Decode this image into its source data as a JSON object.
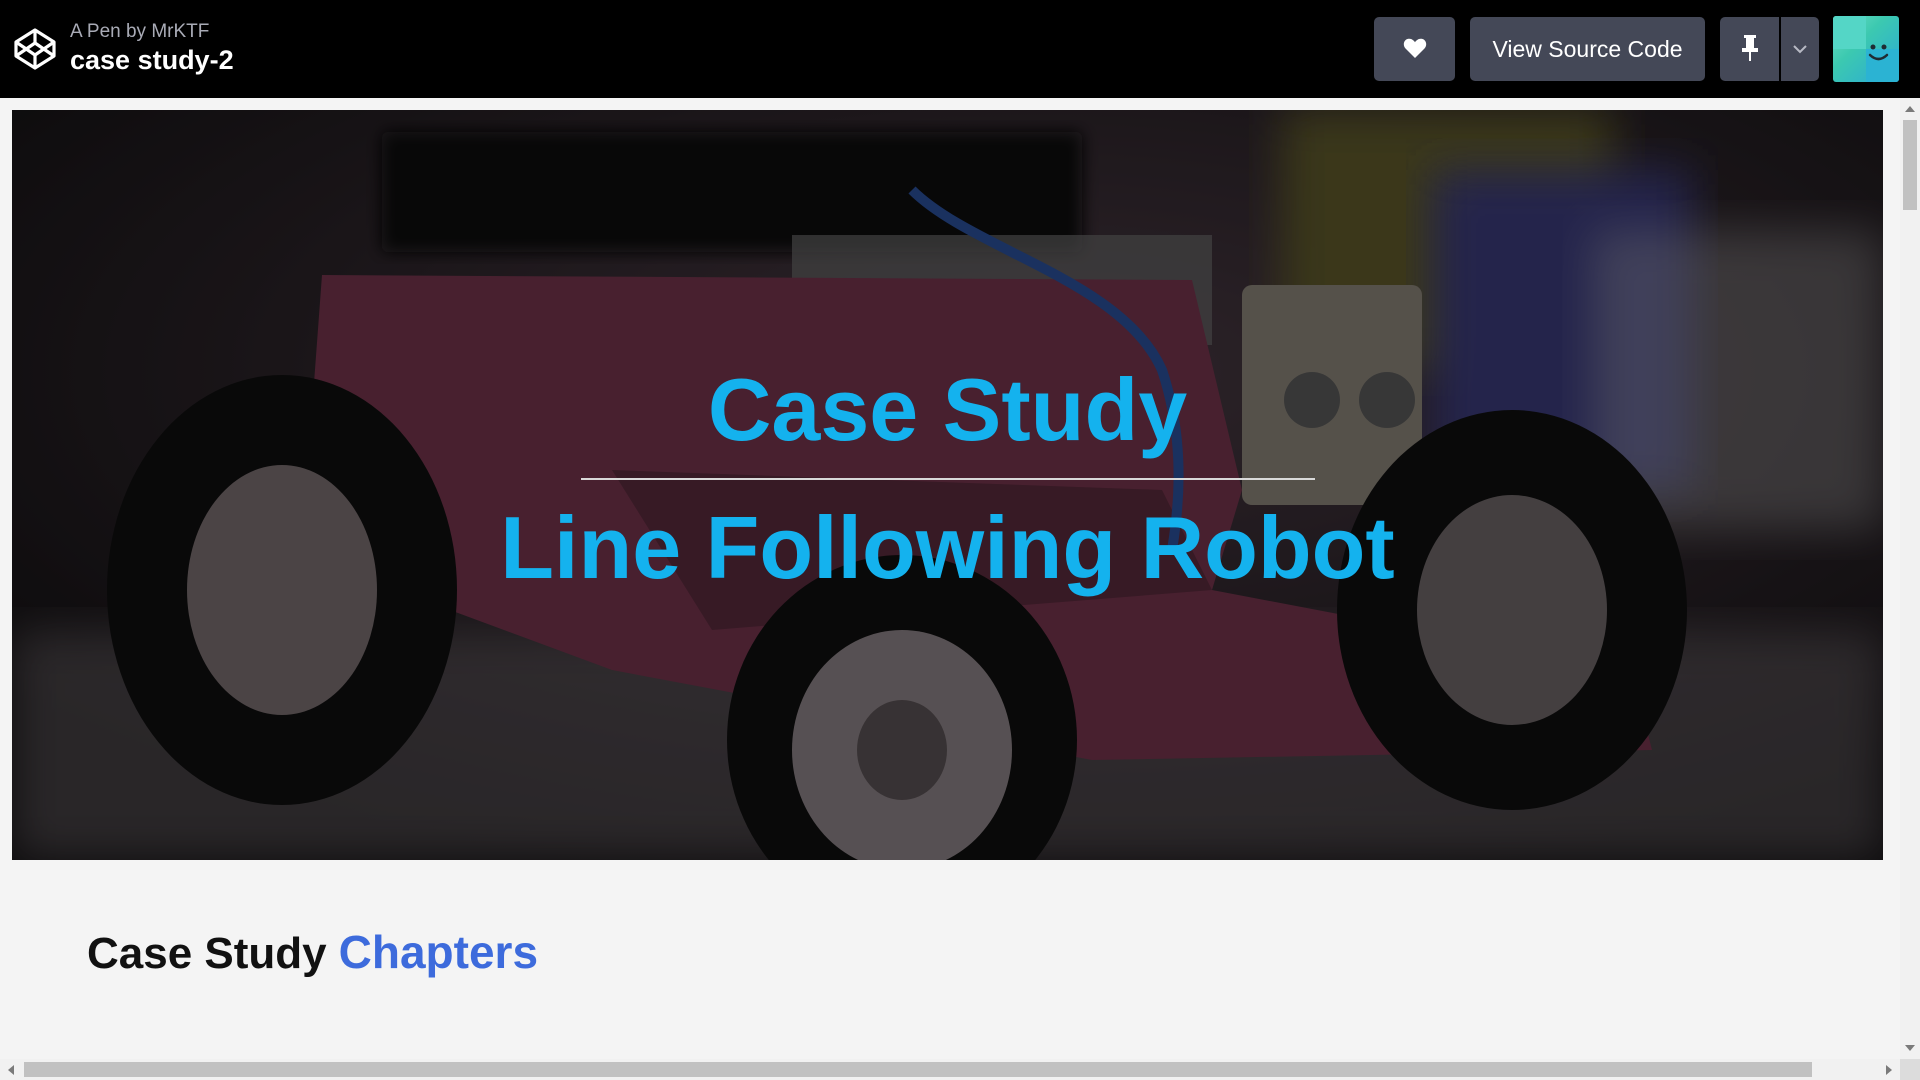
{
  "header": {
    "pen_by": "A Pen by MrKTF",
    "pen_title": "case study-2",
    "view_source_label": "View Source Code",
    "icons": {
      "logo": "codepen-logo-icon",
      "heart": "heart-icon",
      "pin": "pin-icon",
      "dropdown": "chevron-down-icon",
      "avatar": "user-avatar"
    }
  },
  "hero": {
    "title": "Case Study",
    "subtitle": "Line Following Robot"
  },
  "content": {
    "heading_part1": "Case Study",
    "heading_part2": "Chapters"
  },
  "colors": {
    "topbar_bg": "#000000",
    "button_bg": "#444857",
    "hero_text": "#14b2ee",
    "chapters_accent": "#3d6bdc",
    "page_bg": "#f4f4f4"
  }
}
